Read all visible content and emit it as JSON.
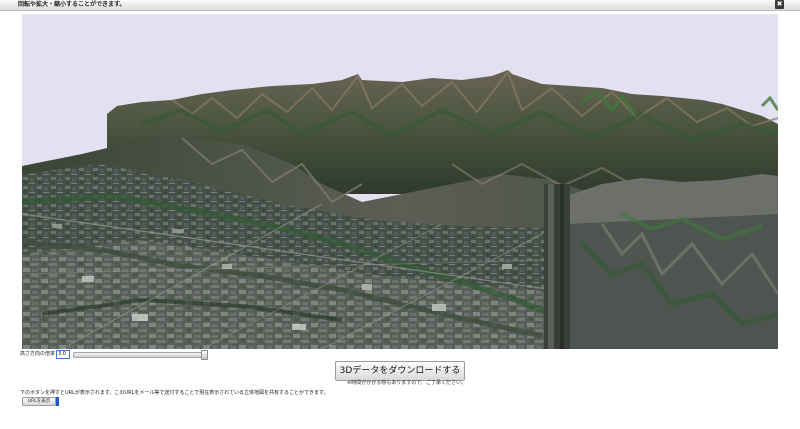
{
  "dialog": {
    "title": "回転や拡大・縮小することができます。",
    "close_icon": "✖"
  },
  "viewer": {
    "description_icon": "3d-terrain-view"
  },
  "controls": {
    "height_label": "高さ方向の倍率 =",
    "height_value": "3.0",
    "slider_value_fraction": 0.97,
    "download_button": "3Dデータをダウンロードする",
    "download_note": "※時間がかかる物もありますので、ご了承ください。",
    "url_instructions": "下のボタンを押すとURLが表示されます。このURLをメール等で送付することで現在表示されている立体地図を共有することができます。",
    "url_button": "URLを表示"
  },
  "colors": {
    "sky": "#e3e0f2",
    "accent": "#1e55c8"
  }
}
